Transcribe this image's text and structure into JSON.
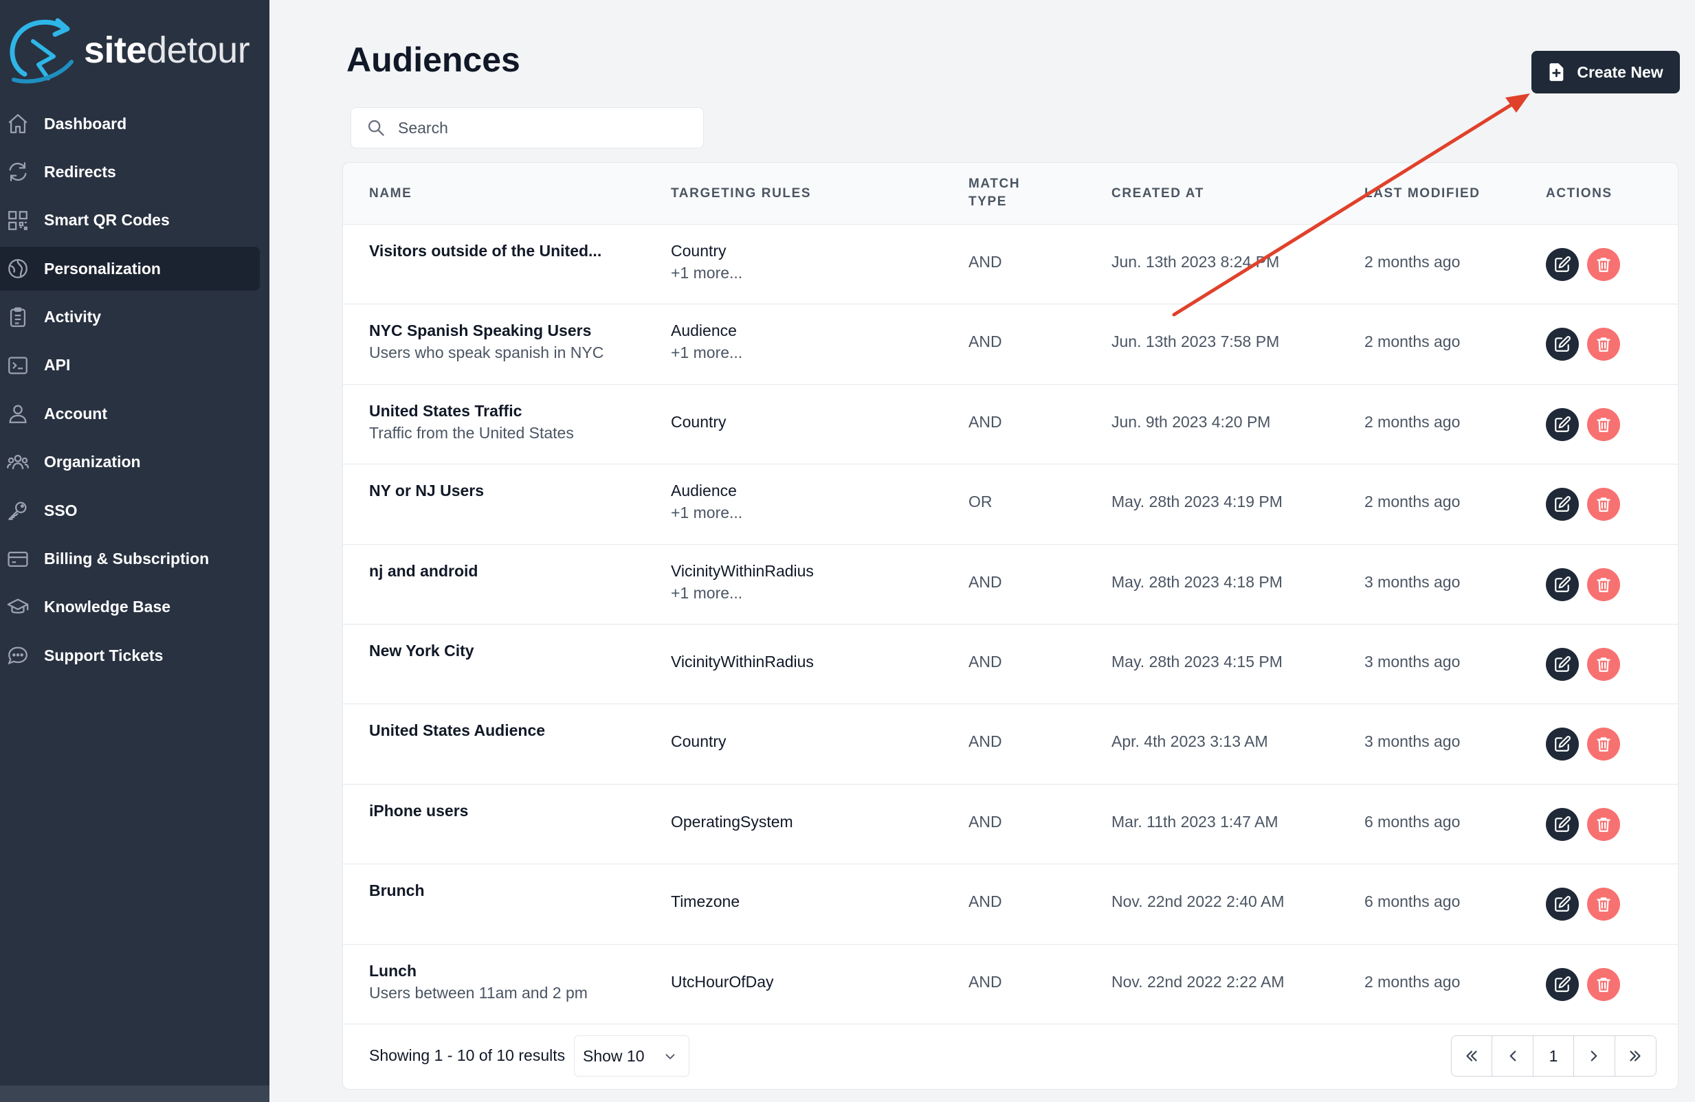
{
  "brand": {
    "logo_bold": "site",
    "logo_light": "detour"
  },
  "sidebar": {
    "items": [
      {
        "label": "Dashboard",
        "icon": "home-icon",
        "active": false
      },
      {
        "label": "Redirects",
        "icon": "refresh-icon",
        "active": false
      },
      {
        "label": "Smart QR Codes",
        "icon": "qr-code-icon",
        "active": false
      },
      {
        "label": "Personalization",
        "icon": "globe-icon",
        "active": true
      },
      {
        "label": "Activity",
        "icon": "clipboard-icon",
        "active": false
      },
      {
        "label": "API",
        "icon": "terminal-icon",
        "active": false
      },
      {
        "label": "Account",
        "icon": "user-icon",
        "active": false
      },
      {
        "label": "Organization",
        "icon": "users-icon",
        "active": false
      },
      {
        "label": "SSO",
        "icon": "key-icon",
        "active": false
      },
      {
        "label": "Billing & Subscription",
        "icon": "credit-card-icon",
        "active": false
      },
      {
        "label": "Knowledge Base",
        "icon": "academic-cap-icon",
        "active": false
      },
      {
        "label": "Support Tickets",
        "icon": "chat-bubble-icon",
        "active": false
      }
    ]
  },
  "header": {
    "title": "Audiences",
    "create_label": "Create New"
  },
  "search": {
    "placeholder": "Search",
    "value": ""
  },
  "table": {
    "columns": {
      "name": "NAME",
      "rules": "TARGETING RULES",
      "match_1": "MATCH",
      "match_2": "TYPE",
      "created": "CREATED AT",
      "modified": "LAST MODIFIED",
      "actions": "ACTIONS"
    },
    "rows": [
      {
        "name": "Visitors outside of the United...",
        "desc": "",
        "rule": "Country",
        "more": "+1 more...",
        "match": "AND",
        "created": "Jun. 13th 2023 8:24 PM",
        "modified": "2 months ago"
      },
      {
        "name": "NYC Spanish Speaking Users",
        "desc": "Users who speak spanish in NYC",
        "rule": "Audience",
        "more": "+1 more...",
        "match": "AND",
        "created": "Jun. 13th 2023 7:58 PM",
        "modified": "2 months ago"
      },
      {
        "name": "United States Traffic",
        "desc": "Traffic from the United States",
        "rule": "Country",
        "more": "",
        "match": "AND",
        "created": "Jun. 9th 2023 4:20 PM",
        "modified": "2 months ago"
      },
      {
        "name": "NY or NJ Users",
        "desc": "",
        "rule": "Audience",
        "more": "+1 more...",
        "match": "OR",
        "created": "May. 28th 2023 4:19 PM",
        "modified": "2 months ago"
      },
      {
        "name": "nj and android",
        "desc": "",
        "rule": "VicinityWithinRadius",
        "more": "+1 more...",
        "match": "AND",
        "created": "May. 28th 2023 4:18 PM",
        "modified": "3 months ago"
      },
      {
        "name": "New York City",
        "desc": "",
        "rule": "VicinityWithinRadius",
        "more": "",
        "match": "AND",
        "created": "May. 28th 2023 4:15 PM",
        "modified": "3 months ago"
      },
      {
        "name": "United States Audience",
        "desc": "",
        "rule": "Country",
        "more": "",
        "match": "AND",
        "created": "Apr. 4th 2023 3:13 AM",
        "modified": "3 months ago"
      },
      {
        "name": "iPhone users",
        "desc": "",
        "rule": "OperatingSystem",
        "more": "",
        "match": "AND",
        "created": "Mar. 11th 2023 1:47 AM",
        "modified": "6 months ago"
      },
      {
        "name": "Brunch",
        "desc": "",
        "rule": "Timezone",
        "more": "",
        "match": "AND",
        "created": "Nov. 22nd 2022 2:40 AM",
        "modified": "6 months ago"
      },
      {
        "name": "Lunch",
        "desc": "Users between 11am and 2 pm",
        "rule": "UtcHourOfDay",
        "more": "",
        "match": "AND",
        "created": "Nov. 22nd 2022 2:22 AM",
        "modified": "2 months ago"
      }
    ]
  },
  "footer": {
    "showing": "Showing 1 - 10 of 10 results",
    "page_size": "Show 10",
    "current_page": "1"
  },
  "colors": {
    "sidebar_bg": "#293241",
    "primary_button": "#1f2937",
    "delete_button": "#f87171",
    "annotation_arrow": "#e0412b",
    "logo_accent": "#2fb6e8"
  }
}
